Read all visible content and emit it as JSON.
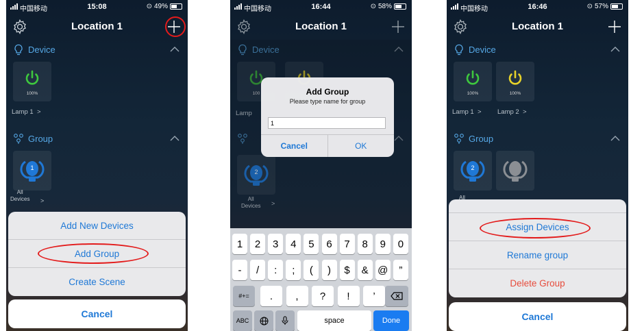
{
  "phones": [
    {
      "status": {
        "carrier": "中国移动",
        "time": "15:08",
        "battery": "49%"
      },
      "nav": {
        "title": "Location 1"
      },
      "device_section": {
        "label": "Device",
        "tiles": [
          {
            "percent": "100%",
            "name": "Lamp 1",
            "chevron": ">"
          }
        ]
      },
      "group_section": {
        "label": "Group",
        "tiles": [
          {
            "number": "1",
            "name_line1": "All",
            "name_line2": "Devices",
            "chevron": ">"
          }
        ]
      },
      "action_sheet": {
        "options": [
          "Add New Devices",
          "Add Group",
          "Create Scene"
        ],
        "cancel": "Cancel"
      }
    },
    {
      "status": {
        "carrier": "中国移动",
        "time": "16:44",
        "battery": "58%"
      },
      "nav": {
        "title": "Location 1"
      },
      "device_section": {
        "label": "Device",
        "tiles": [
          {
            "percent": "100",
            "name": "Lamp"
          }
        ]
      },
      "group_section": {
        "label": "Group",
        "tiles": [
          {
            "number": "2",
            "name_line1": "All",
            "name_line2": "Devices",
            "chevron": ">"
          }
        ]
      },
      "dialog": {
        "title": "Add Group",
        "message": "Please type name for group",
        "value": "1",
        "cancel": "Cancel",
        "ok": "OK"
      },
      "keyboard": {
        "row1": [
          "1",
          "2",
          "3",
          "4",
          "5",
          "6",
          "7",
          "8",
          "9",
          "0"
        ],
        "row2": [
          "-",
          "/",
          ":",
          ";",
          "(",
          ")",
          "$",
          "&",
          "@",
          "”"
        ],
        "row3_left": "#+=",
        "row3": [
          ".",
          ",",
          "?",
          "!",
          "’"
        ],
        "abc": "ABC",
        "space": "space",
        "done": "Done"
      }
    },
    {
      "status": {
        "carrier": "中国移动",
        "time": "16:46",
        "battery": "57%"
      },
      "nav": {
        "title": "Location 1"
      },
      "device_section": {
        "label": "Device",
        "tiles": [
          {
            "percent": "100%",
            "name": "Lamp 1",
            "chevron": ">"
          },
          {
            "percent": "100%",
            "name": "Lamp 2",
            "chevron": ">"
          }
        ]
      },
      "group_section": {
        "label": "Group",
        "tiles": [
          {
            "number": "2",
            "name_line1": "All"
          }
        ]
      },
      "action_sheet": {
        "options": [
          "Assign Devices",
          "Rename group",
          "Delete Group"
        ],
        "cancel": "Cancel"
      }
    }
  ],
  "colors": {
    "accent_blue": "#1e78d6",
    "section_blue": "#56a8e6",
    "power_green": "#3ec83e",
    "power_yellow": "#e6d22a",
    "highlight_red": "#e31b1b",
    "danger_red": "#e74c3c"
  }
}
